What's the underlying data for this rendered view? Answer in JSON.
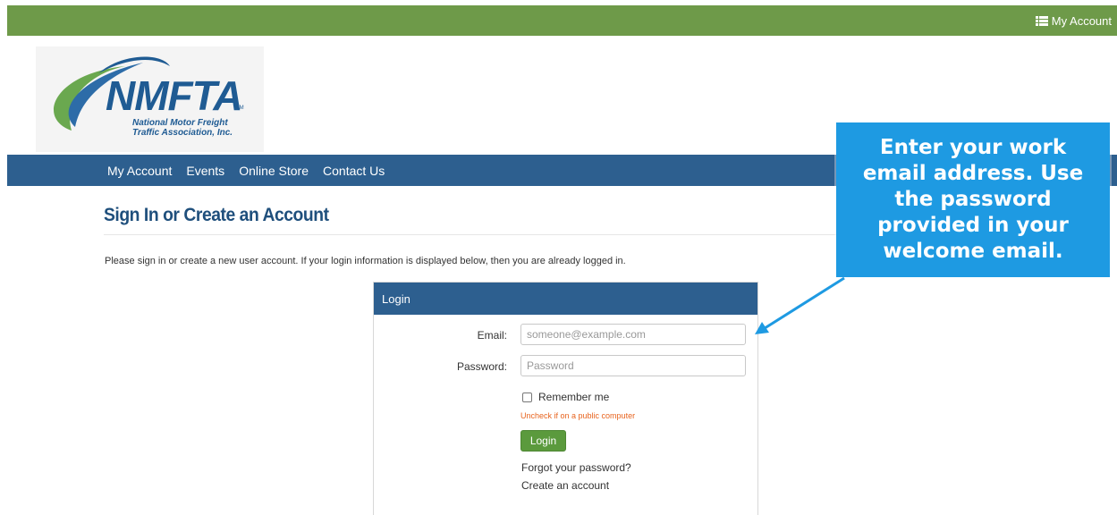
{
  "top_bar": {
    "account_label": "My Account",
    "account_icon": "list-icon"
  },
  "logo": {
    "wordmark": "NMFTA",
    "trademark": "TM",
    "subtitle_line1": "National Motor Freight",
    "subtitle_line2": "Traffic Association, Inc.",
    "colors": {
      "blue": "#1f5b93",
      "green": "#6aa84f"
    }
  },
  "nav": {
    "items": [
      {
        "label": "My Account"
      },
      {
        "label": "Events"
      },
      {
        "label": "Online Store"
      },
      {
        "label": "Contact Us"
      }
    ]
  },
  "page": {
    "title": "Sign In or Create an Account",
    "intro": "Please sign in or create a new user account. If your login information is displayed below, then you are already logged in."
  },
  "login": {
    "header": "Login",
    "email_label": "Email:",
    "email_placeholder": "someone@example.com",
    "password_label": "Password:",
    "password_placeholder": "Password",
    "remember_label": "Remember me",
    "remember_hint": "Uncheck if on a public computer",
    "submit_label": "Login",
    "forgot_link": "Forgot your password?",
    "create_link": "Create an account"
  },
  "callout": {
    "text": "Enter your work email address. Use the password provided in your welcome email.",
    "color": "#1e9ae2"
  },
  "theme": {
    "green": "#6e9a49",
    "blue": "#2d5f8f",
    "button_green": "#5b9a3d",
    "hint_orange": "#e8641f"
  }
}
